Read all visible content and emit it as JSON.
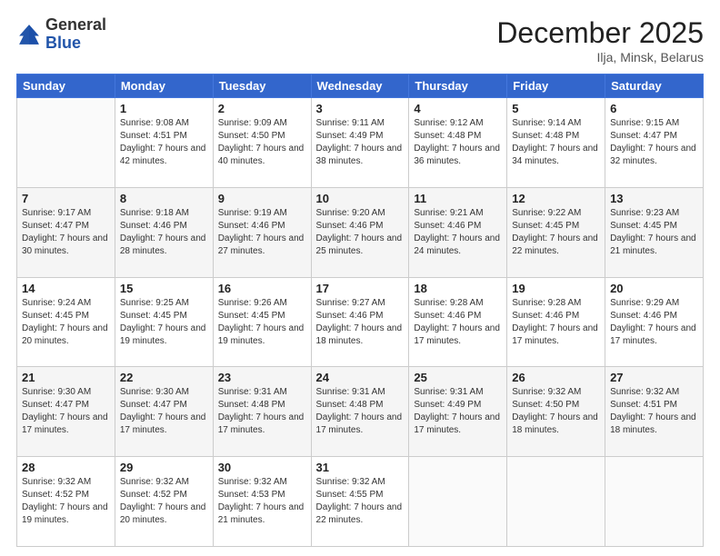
{
  "header": {
    "logo_general": "General",
    "logo_blue": "Blue",
    "month_title": "December 2025",
    "location": "Ilja, Minsk, Belarus"
  },
  "weekdays": [
    "Sunday",
    "Monday",
    "Tuesday",
    "Wednesday",
    "Thursday",
    "Friday",
    "Saturday"
  ],
  "weeks": [
    [
      {
        "day": "",
        "sunrise": "",
        "sunset": "",
        "daylight": ""
      },
      {
        "day": "1",
        "sunrise": "Sunrise: 9:08 AM",
        "sunset": "Sunset: 4:51 PM",
        "daylight": "Daylight: 7 hours and 42 minutes."
      },
      {
        "day": "2",
        "sunrise": "Sunrise: 9:09 AM",
        "sunset": "Sunset: 4:50 PM",
        "daylight": "Daylight: 7 hours and 40 minutes."
      },
      {
        "day": "3",
        "sunrise": "Sunrise: 9:11 AM",
        "sunset": "Sunset: 4:49 PM",
        "daylight": "Daylight: 7 hours and 38 minutes."
      },
      {
        "day": "4",
        "sunrise": "Sunrise: 9:12 AM",
        "sunset": "Sunset: 4:48 PM",
        "daylight": "Daylight: 7 hours and 36 minutes."
      },
      {
        "day": "5",
        "sunrise": "Sunrise: 9:14 AM",
        "sunset": "Sunset: 4:48 PM",
        "daylight": "Daylight: 7 hours and 34 minutes."
      },
      {
        "day": "6",
        "sunrise": "Sunrise: 9:15 AM",
        "sunset": "Sunset: 4:47 PM",
        "daylight": "Daylight: 7 hours and 32 minutes."
      }
    ],
    [
      {
        "day": "7",
        "sunrise": "Sunrise: 9:17 AM",
        "sunset": "Sunset: 4:47 PM",
        "daylight": "Daylight: 7 hours and 30 minutes."
      },
      {
        "day": "8",
        "sunrise": "Sunrise: 9:18 AM",
        "sunset": "Sunset: 4:46 PM",
        "daylight": "Daylight: 7 hours and 28 minutes."
      },
      {
        "day": "9",
        "sunrise": "Sunrise: 9:19 AM",
        "sunset": "Sunset: 4:46 PM",
        "daylight": "Daylight: 7 hours and 27 minutes."
      },
      {
        "day": "10",
        "sunrise": "Sunrise: 9:20 AM",
        "sunset": "Sunset: 4:46 PM",
        "daylight": "Daylight: 7 hours and 25 minutes."
      },
      {
        "day": "11",
        "sunrise": "Sunrise: 9:21 AM",
        "sunset": "Sunset: 4:46 PM",
        "daylight": "Daylight: 7 hours and 24 minutes."
      },
      {
        "day": "12",
        "sunrise": "Sunrise: 9:22 AM",
        "sunset": "Sunset: 4:45 PM",
        "daylight": "Daylight: 7 hours and 22 minutes."
      },
      {
        "day": "13",
        "sunrise": "Sunrise: 9:23 AM",
        "sunset": "Sunset: 4:45 PM",
        "daylight": "Daylight: 7 hours and 21 minutes."
      }
    ],
    [
      {
        "day": "14",
        "sunrise": "Sunrise: 9:24 AM",
        "sunset": "Sunset: 4:45 PM",
        "daylight": "Daylight: 7 hours and 20 minutes."
      },
      {
        "day": "15",
        "sunrise": "Sunrise: 9:25 AM",
        "sunset": "Sunset: 4:45 PM",
        "daylight": "Daylight: 7 hours and 19 minutes."
      },
      {
        "day": "16",
        "sunrise": "Sunrise: 9:26 AM",
        "sunset": "Sunset: 4:45 PM",
        "daylight": "Daylight: 7 hours and 19 minutes."
      },
      {
        "day": "17",
        "sunrise": "Sunrise: 9:27 AM",
        "sunset": "Sunset: 4:46 PM",
        "daylight": "Daylight: 7 hours and 18 minutes."
      },
      {
        "day": "18",
        "sunrise": "Sunrise: 9:28 AM",
        "sunset": "Sunset: 4:46 PM",
        "daylight": "Daylight: 7 hours and 17 minutes."
      },
      {
        "day": "19",
        "sunrise": "Sunrise: 9:28 AM",
        "sunset": "Sunset: 4:46 PM",
        "daylight": "Daylight: 7 hours and 17 minutes."
      },
      {
        "day": "20",
        "sunrise": "Sunrise: 9:29 AM",
        "sunset": "Sunset: 4:46 PM",
        "daylight": "Daylight: 7 hours and 17 minutes."
      }
    ],
    [
      {
        "day": "21",
        "sunrise": "Sunrise: 9:30 AM",
        "sunset": "Sunset: 4:47 PM",
        "daylight": "Daylight: 7 hours and 17 minutes."
      },
      {
        "day": "22",
        "sunrise": "Sunrise: 9:30 AM",
        "sunset": "Sunset: 4:47 PM",
        "daylight": "Daylight: 7 hours and 17 minutes."
      },
      {
        "day": "23",
        "sunrise": "Sunrise: 9:31 AM",
        "sunset": "Sunset: 4:48 PM",
        "daylight": "Daylight: 7 hours and 17 minutes."
      },
      {
        "day": "24",
        "sunrise": "Sunrise: 9:31 AM",
        "sunset": "Sunset: 4:48 PM",
        "daylight": "Daylight: 7 hours and 17 minutes."
      },
      {
        "day": "25",
        "sunrise": "Sunrise: 9:31 AM",
        "sunset": "Sunset: 4:49 PM",
        "daylight": "Daylight: 7 hours and 17 minutes."
      },
      {
        "day": "26",
        "sunrise": "Sunrise: 9:32 AM",
        "sunset": "Sunset: 4:50 PM",
        "daylight": "Daylight: 7 hours and 18 minutes."
      },
      {
        "day": "27",
        "sunrise": "Sunrise: 9:32 AM",
        "sunset": "Sunset: 4:51 PM",
        "daylight": "Daylight: 7 hours and 18 minutes."
      }
    ],
    [
      {
        "day": "28",
        "sunrise": "Sunrise: 9:32 AM",
        "sunset": "Sunset: 4:52 PM",
        "daylight": "Daylight: 7 hours and 19 minutes."
      },
      {
        "day": "29",
        "sunrise": "Sunrise: 9:32 AM",
        "sunset": "Sunset: 4:52 PM",
        "daylight": "Daylight: 7 hours and 20 minutes."
      },
      {
        "day": "30",
        "sunrise": "Sunrise: 9:32 AM",
        "sunset": "Sunset: 4:53 PM",
        "daylight": "Daylight: 7 hours and 21 minutes."
      },
      {
        "day": "31",
        "sunrise": "Sunrise: 9:32 AM",
        "sunset": "Sunset: 4:55 PM",
        "daylight": "Daylight: 7 hours and 22 minutes."
      },
      {
        "day": "",
        "sunrise": "",
        "sunset": "",
        "daylight": ""
      },
      {
        "day": "",
        "sunrise": "",
        "sunset": "",
        "daylight": ""
      },
      {
        "day": "",
        "sunrise": "",
        "sunset": "",
        "daylight": ""
      }
    ]
  ]
}
